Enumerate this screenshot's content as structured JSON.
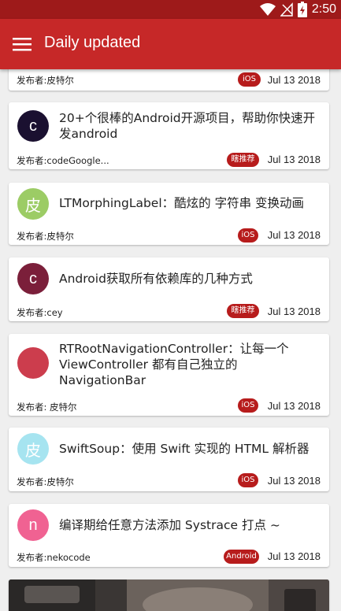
{
  "status_bar": {
    "time": "2:50",
    "icons": [
      "wifi-icon",
      "signal-off-icon",
      "battery-charging-icon"
    ]
  },
  "app_bar": {
    "title": "Daily updated",
    "menu_icon": "menu-icon",
    "color": "#c62828"
  },
  "feed": {
    "items": [
      {
        "avatar_letter": "",
        "avatar_color": "",
        "title": "",
        "publisher": "发布者:皮特尔",
        "tag": "iOS",
        "date": "Jul 13 2018"
      },
      {
        "avatar_letter": "c",
        "avatar_color": "#1a1030",
        "title": "20+个很棒的Android开源项目，帮助你快速开发android",
        "publisher": "发布者:codeGoogle...",
        "tag": "瞎推荐",
        "date": "Jul 13 2018"
      },
      {
        "avatar_letter": "皮",
        "avatar_color": "#9ccc65",
        "title": "LTMorphingLabel：酷炫的 字符串 变换动画",
        "publisher": "发布者:皮特尔",
        "tag": "iOS",
        "date": "Jul 13 2018"
      },
      {
        "avatar_letter": "c",
        "avatar_color": "#7b1f3a",
        "title": "Android获取所有依赖库的几种方式",
        "publisher": "发布者:cey",
        "tag": "瞎推荐",
        "date": "Jul 13 2018"
      },
      {
        "avatar_letter": "",
        "avatar_color": "#cc3d4d",
        "title": "RTRootNavigationController：让每一个 ViewController 都有自己独立的 NavigationBar",
        "publisher": "发布者: 皮特尔",
        "tag": "iOS",
        "date": "Jul 13 2018"
      },
      {
        "avatar_letter": "皮",
        "avatar_color": "#a6e4f0",
        "title": "SwiftSoup：使用 Swift 实现的 HTML 解析器",
        "publisher": "发布者:皮特尔",
        "tag": "iOS",
        "date": "Jul 13 2018"
      },
      {
        "avatar_letter": "n",
        "avatar_color": "#f06292",
        "title": "编译期给任意方法添加 Systrace 打点 ~",
        "publisher": "发布者:nekocode",
        "tag": "Android",
        "date": "Jul 13 2018"
      }
    ]
  },
  "colors": {
    "status_bar": "#9e1a1a",
    "tag_background": "#b71c1c",
    "background": "#efefef"
  }
}
